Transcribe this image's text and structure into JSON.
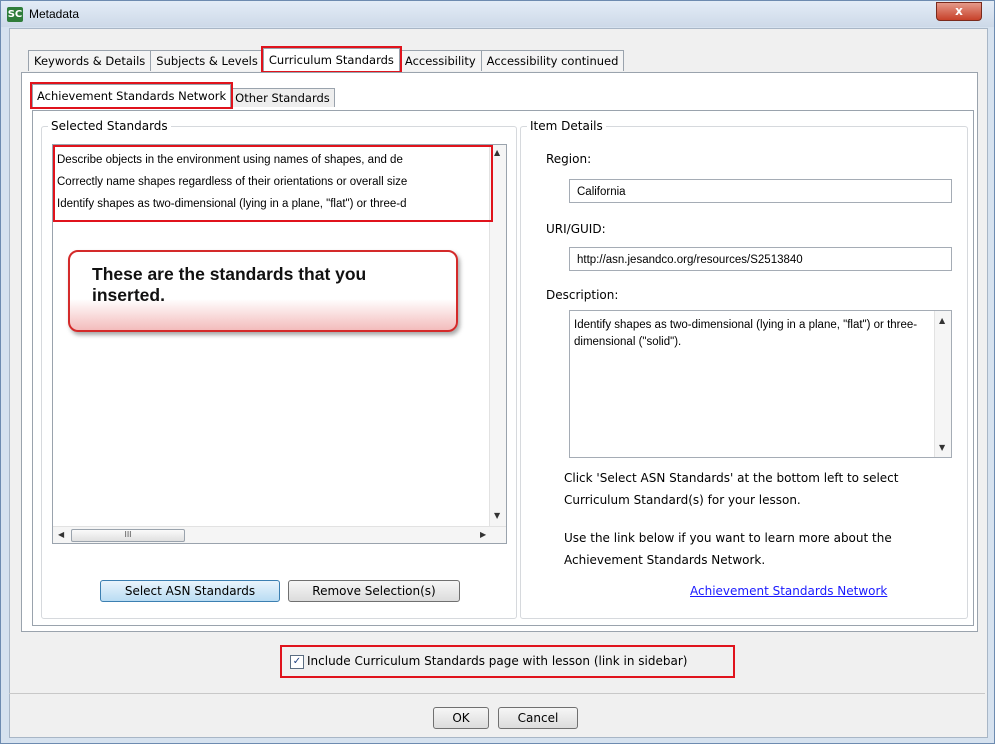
{
  "window": {
    "title": "Metadata",
    "app_icon": "SC",
    "close_glyph": "x"
  },
  "tabs": [
    {
      "label": "Keywords & Details"
    },
    {
      "label": "Subjects & Levels"
    },
    {
      "label": "Curriculum Standards"
    },
    {
      "label": "Accessibility"
    },
    {
      "label": "Accessibility continued"
    }
  ],
  "subtabs": [
    {
      "label": "Achievement Standards Network"
    },
    {
      "label": "Other Standards"
    }
  ],
  "selected_standards": {
    "legend": "Selected Standards",
    "items": [
      "Describe objects in the environment using names of shapes, and de",
      "Correctly name shapes regardless of their orientations or overall size",
      "Identify shapes as two-dimensional (lying in a plane, \"flat\") or three-d"
    ],
    "callout": "These are the standards that you inserted.",
    "select_button": "Select ASN Standards",
    "remove_button": "Remove Selection(s)",
    "scroll_thumb_glyph": "III"
  },
  "item_details": {
    "legend": "Item Details",
    "region_label": "Region:",
    "region_value": "California",
    "uri_label": "URI/GUID:",
    "uri_value": "http://asn.jesandco.org/resources/S2513840",
    "description_label": "Description:",
    "description_value": "Identify shapes as two-dimensional (lying in a plane, \"flat\") or three-dimensional (\"solid\").",
    "help_1": "Click 'Select ASN Standards' at the bottom left to select Curriculum Standard(s) for your lesson.",
    "help_2": "Use the link below if you want to learn more about the Achievement Standards Network.",
    "link_label": "Achievement Standards Network"
  },
  "include_checkbox": {
    "checked": true,
    "label": "Include Curriculum Standards page with lesson (link in sidebar)"
  },
  "footer": {
    "ok_label": "OK",
    "cancel_label": "Cancel"
  },
  "colors": {
    "highlight": "#e0131c",
    "link": "#1a1aff",
    "default_button": "#b9dcf3"
  }
}
